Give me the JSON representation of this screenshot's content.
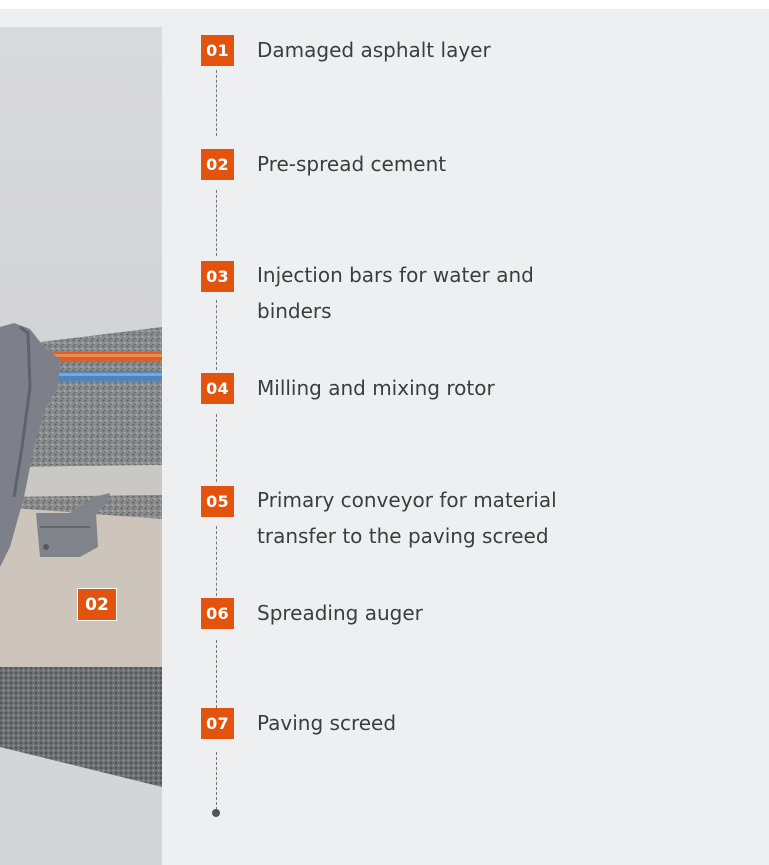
{
  "image": {
    "marker_label": "02"
  },
  "steps": [
    {
      "number": "01",
      "label": "Damaged asphalt layer"
    },
    {
      "number": "02",
      "label": "Pre-spread cement"
    },
    {
      "number": "03",
      "label": "Injection bars for water and binders"
    },
    {
      "number": "04",
      "label": "Milling and mixing rotor"
    },
    {
      "number": "05",
      "label": "Primary conveyor for material transfer to the paving screed"
    },
    {
      "number": "06",
      "label": "Spreading auger"
    },
    {
      "number": "07",
      "label": "Paving screed"
    }
  ],
  "colors": {
    "accent": "#e2540e",
    "panel_background": "#eeeff1",
    "text": "#3d3d3d"
  }
}
